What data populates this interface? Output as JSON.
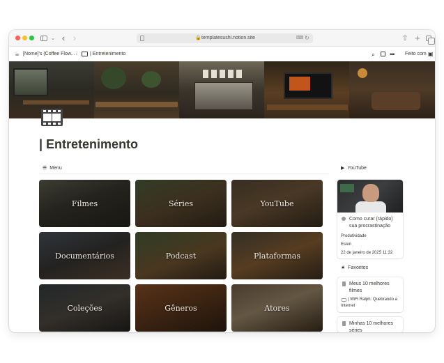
{
  "browser": {
    "url": "templatesushi.notion.site",
    "icons": [
      "sidebar-icon",
      "chevron-down-icon",
      "back-icon",
      "forward-icon",
      "lock-icon",
      "translate-icon",
      "reload-icon",
      "share-icon",
      "plus-icon",
      "tabs-icon"
    ]
  },
  "notion_bar": {
    "breadcrumb_1": "[Nome]'s (Coffee Flow...",
    "breadcrumb_sep": "/",
    "breadcrumb_2": "| Entretenimento",
    "made_with": "Feito com"
  },
  "page": {
    "title": "| Entretenimento",
    "icon": "film-icon"
  },
  "menu": {
    "label": "Menu",
    "items": [
      {
        "label": "Filmes"
      },
      {
        "label": "Séries"
      },
      {
        "label": "YouTube"
      },
      {
        "label": "Documentários"
      },
      {
        "label": "Podcast"
      },
      {
        "label": "Plataformas"
      },
      {
        "label": "Coleções"
      },
      {
        "label": "Gêneros"
      },
      {
        "label": "Atores"
      }
    ]
  },
  "youtube": {
    "label": "YouTube",
    "card": {
      "title": "Como curar (rápido) sua procrastinação",
      "category": "Produtividade",
      "author": "Eslen",
      "date": "22 de janeiro de 2025 11:32"
    }
  },
  "favorites": {
    "label": "Favoritos",
    "items": [
      {
        "title": "Meus 10 melhores filmes",
        "subtitle": "| WiFi Ralph: Quebrando a Internet"
      },
      {
        "title": "Minhas 10 melhores séries"
      }
    ]
  },
  "colors": {
    "text": "#37352f",
    "muted": "#9b9a97",
    "close": "#ff5f57",
    "minimize": "#febc2e",
    "maximize": "#28c840"
  }
}
